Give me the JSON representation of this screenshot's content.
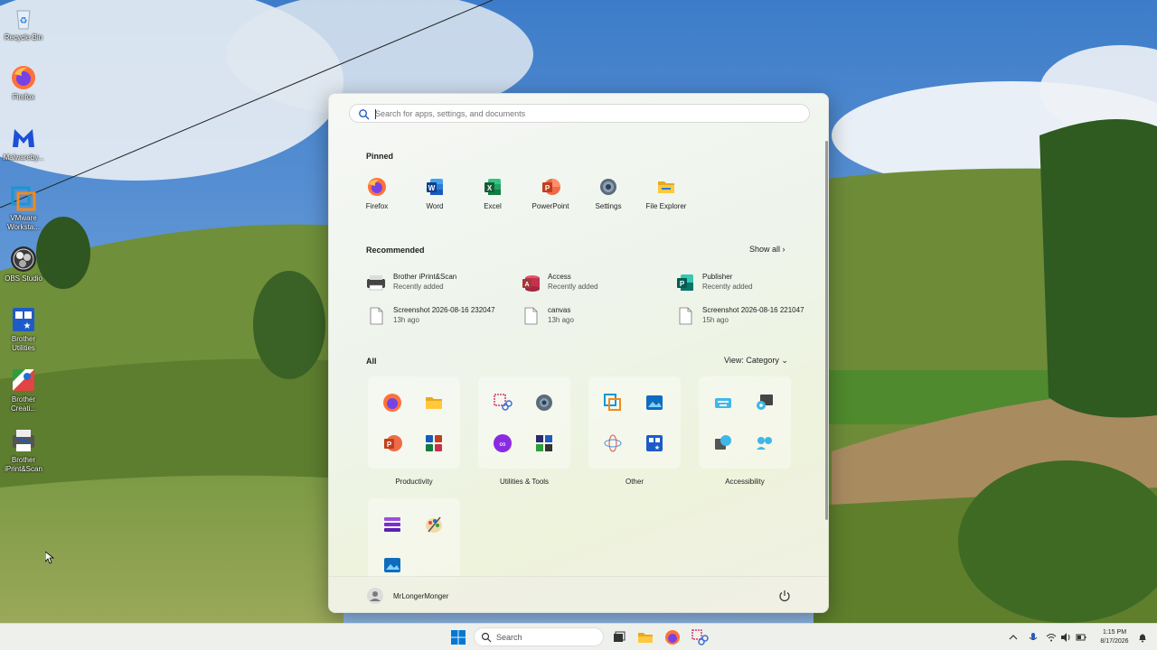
{
  "desktop": {
    "icons": [
      {
        "label": "Recycle Bin",
        "icon": "recycle-bin-icon"
      },
      {
        "label": "Firefox",
        "icon": "firefox-icon"
      },
      {
        "label": "Malwareby...",
        "icon": "malwarebytes-icon"
      },
      {
        "label": "VMware\nWorksta...",
        "icon": "vmware-icon"
      },
      {
        "label": "OBS Studio",
        "icon": "obs-icon"
      },
      {
        "label": "Brother\nUtilities",
        "icon": "brother-utilities-icon"
      },
      {
        "label": "Brother\nCreati...",
        "icon": "brother-creative-icon"
      },
      {
        "label": "Brother\niPrint&Scan",
        "icon": "brother-iprint-icon"
      }
    ]
  },
  "start_menu": {
    "search_placeholder": "Search for apps, settings, and documents",
    "pinned_title": "Pinned",
    "pinned": [
      {
        "label": "Firefox",
        "icon": "firefox-icon"
      },
      {
        "label": "Word",
        "icon": "word-icon"
      },
      {
        "label": "Excel",
        "icon": "excel-icon"
      },
      {
        "label": "PowerPoint",
        "icon": "powerpoint-icon"
      },
      {
        "label": "Settings",
        "icon": "gear-icon"
      },
      {
        "label": "File Explorer",
        "icon": "folder-icon"
      }
    ],
    "recommended_title": "Recommended",
    "show_all": "Show all",
    "recommended": [
      {
        "name": "Brother iPrint&Scan",
        "sub": "Recently added",
        "icon": "scanner-icon"
      },
      {
        "name": "Access",
        "sub": "Recently added",
        "icon": "access-icon"
      },
      {
        "name": "Publisher",
        "sub": "Recently added",
        "icon": "publisher-icon"
      },
      {
        "name": "Screenshot 2026-08-16 232047",
        "sub": "13h ago",
        "icon": "file-icon"
      },
      {
        "name": "canvas",
        "sub": "13h ago",
        "icon": "file-icon"
      },
      {
        "name": "Screenshot 2026-08-16 221047",
        "sub": "15h ago",
        "icon": "file-icon"
      }
    ],
    "all_title": "All",
    "view_label": "View: Category",
    "categories": [
      {
        "label": "Productivity"
      },
      {
        "label": "Utilities & Tools"
      },
      {
        "label": "Other"
      },
      {
        "label": "Accessibility"
      }
    ],
    "user_name": "MrLongerMonger"
  },
  "taskbar": {
    "search_label": "Search",
    "time": "1:15 PM",
    "date": "8/17/2026"
  }
}
